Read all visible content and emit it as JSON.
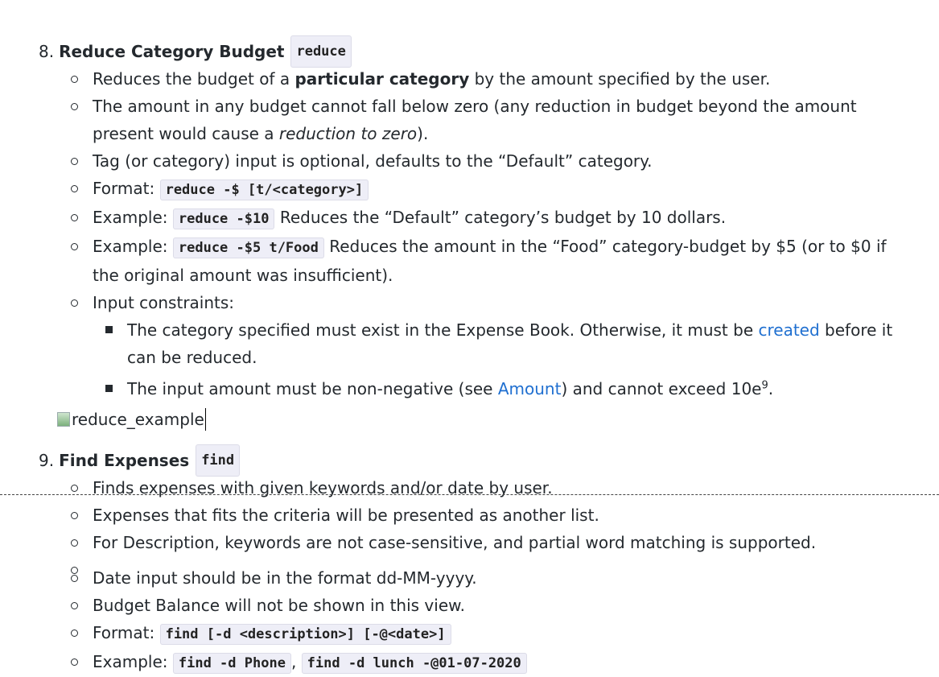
{
  "reduce": {
    "number": "8.",
    "title": "Reduce Category Budget",
    "command": "reduce",
    "bullet1_a": "Reduces the budget of a ",
    "bullet1_b": "particular category",
    "bullet1_c": " by the amount specified by the user.",
    "bullet2_a": "The amount in any budget cannot fall below zero (any reduction in budget beyond the amount present would cause a ",
    "bullet2_b": "reduction to zero",
    "bullet2_c": ").",
    "bullet3": "Tag (or category) input is optional, defaults to the “Default” category.",
    "format_label": "Format: ",
    "format_code": "reduce -$ [t/<category>]",
    "example1_label": "Example: ",
    "example1_code": "reduce -$10",
    "example1_text": " Reduces the “Default” category’s budget by 10 dollars.",
    "example2_label": "Example: ",
    "example2_code": "reduce -$5 t/Food",
    "example2_text": " Reduces the amount in the “Food” category-budget by $5 (or to $0 if the original amount was insufficient).",
    "constraints_label": "Input constraints:",
    "constraint1_a": "The category specified must exist in the Expense Book. Otherwise, it must be ",
    "constraint1_link": "created",
    "constraint1_b": " before it can be reduced.",
    "constraint2_a": "The input amount must be non-negative (see ",
    "constraint2_link": "Amount",
    "constraint2_b": ") and cannot exceed 10e",
    "constraint2_sup": "9",
    "constraint2_c": ".",
    "image_alt": "reduce_example"
  },
  "find": {
    "number": "9.",
    "title": "Find Expenses",
    "command": "find",
    "bullet1": "Finds expenses with given keywords and/or date by user.",
    "bullet2": "Expenses that fits the criteria will be presented as another list.",
    "bullet3": "For Description, keywords are not case-sensitive, and partial word matching is supported.",
    "bullet4": "Date input should be in the format dd-MM-yyyy.",
    "bullet5": "Budget Balance will not be shown in this view.",
    "format_label": "Format: ",
    "format_code": "find [-d <description>] [-@<date>]",
    "example_label": "Example: ",
    "example_code1": "find -d Phone",
    "example_sep": ",",
    "example_code2": "find -d lunch -@01-07-2020"
  },
  "colors": {
    "link": "#1f6fd0",
    "code_bg": "#eeeef7",
    "text": "#24292e"
  }
}
